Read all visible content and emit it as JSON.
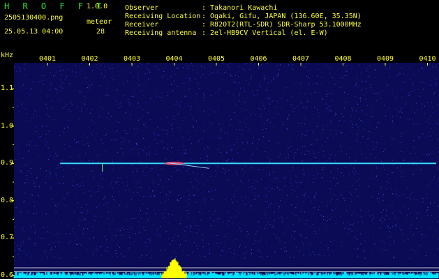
{
  "header": {
    "app_name": "H R O F F T",
    "version": "1.0.0",
    "filename": "2505130400.png",
    "meteor_label": "meteor",
    "timestamp": "25.05.13 04:00",
    "meteor_count": "28",
    "info": [
      {
        "label": "Observer",
        "value": ": Takanori Kawachi"
      },
      {
        "label": "Receiving Location",
        "value": ": Ogaki, Gifu, JAPAN (136.60E, 35.35N)"
      },
      {
        "label": "Receiver",
        "value": ": R820T2(RTL-SDR) SDR-Sharp 53.1000MHz"
      },
      {
        "label": "Receiving antenna",
        "value": ": 2el-HB9CV Vertical (el. E-W)"
      }
    ]
  },
  "colors": {
    "text": "#2ee62e",
    "axis": "#ffff33",
    "background": "#0a0a55",
    "carrier": "#33ddff",
    "spectrum": "#00e5ff"
  },
  "chart_data": {
    "type": "heatmap",
    "ylabel": "kHz",
    "x_ticks": [
      "0401",
      "0402",
      "0403",
      "0404",
      "0405",
      "0406",
      "0407",
      "0408",
      "0409",
      "0410"
    ],
    "y_ticks": [
      "1.1",
      "1.0",
      "0.9",
      "0.8",
      "0.7",
      "0.6"
    ],
    "ylim": [
      0.59,
      1.17
    ],
    "carrier_khz": 0.9,
    "carrier_start_min": 0.3,
    "meteor_echo_min": 3.0,
    "spectrum_peak_min": 3.0
  }
}
